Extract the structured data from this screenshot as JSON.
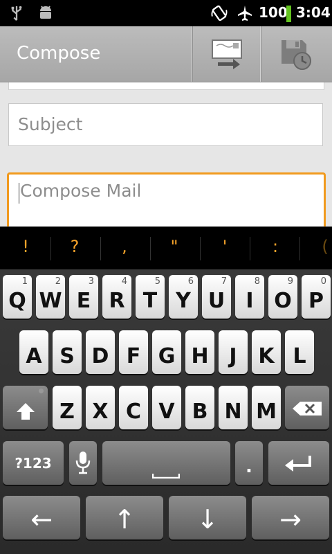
{
  "status_bar": {
    "battery_level": "100",
    "clock": "3:04",
    "icons": [
      "usb-icon",
      "android-debug-icon",
      "auto-rotate-icon",
      "airplane-mode-icon",
      "battery-icon"
    ],
    "battery_color": "#63c41f"
  },
  "action_bar": {
    "title": "Compose",
    "buttons": [
      "send-icon",
      "save-draft-icon"
    ]
  },
  "form": {
    "subject_placeholder": "Subject",
    "body_placeholder": "Compose Mail",
    "focus_color": "#f19a1e"
  },
  "suggestions": [
    "!",
    "?",
    ",",
    "\"",
    "'",
    ":",
    "("
  ],
  "keyboard": {
    "row1": [
      {
        "k": "Q",
        "n": "1"
      },
      {
        "k": "W",
        "n": "2"
      },
      {
        "k": "E",
        "n": "3"
      },
      {
        "k": "R",
        "n": "4"
      },
      {
        "k": "T",
        "n": "5"
      },
      {
        "k": "Y",
        "n": "6"
      },
      {
        "k": "U",
        "n": "7"
      },
      {
        "k": "I",
        "n": "8"
      },
      {
        "k": "O",
        "n": "9"
      },
      {
        "k": "P",
        "n": "0"
      }
    ],
    "row2": [
      "A",
      "S",
      "D",
      "F",
      "G",
      "H",
      "J",
      "K",
      "L"
    ],
    "row3": [
      "Z",
      "X",
      "C",
      "V",
      "B",
      "N",
      "M"
    ],
    "symbols_key": "?123",
    "period_key": ".",
    "arrows": [
      "←",
      "↑",
      "↓",
      "→"
    ]
  }
}
